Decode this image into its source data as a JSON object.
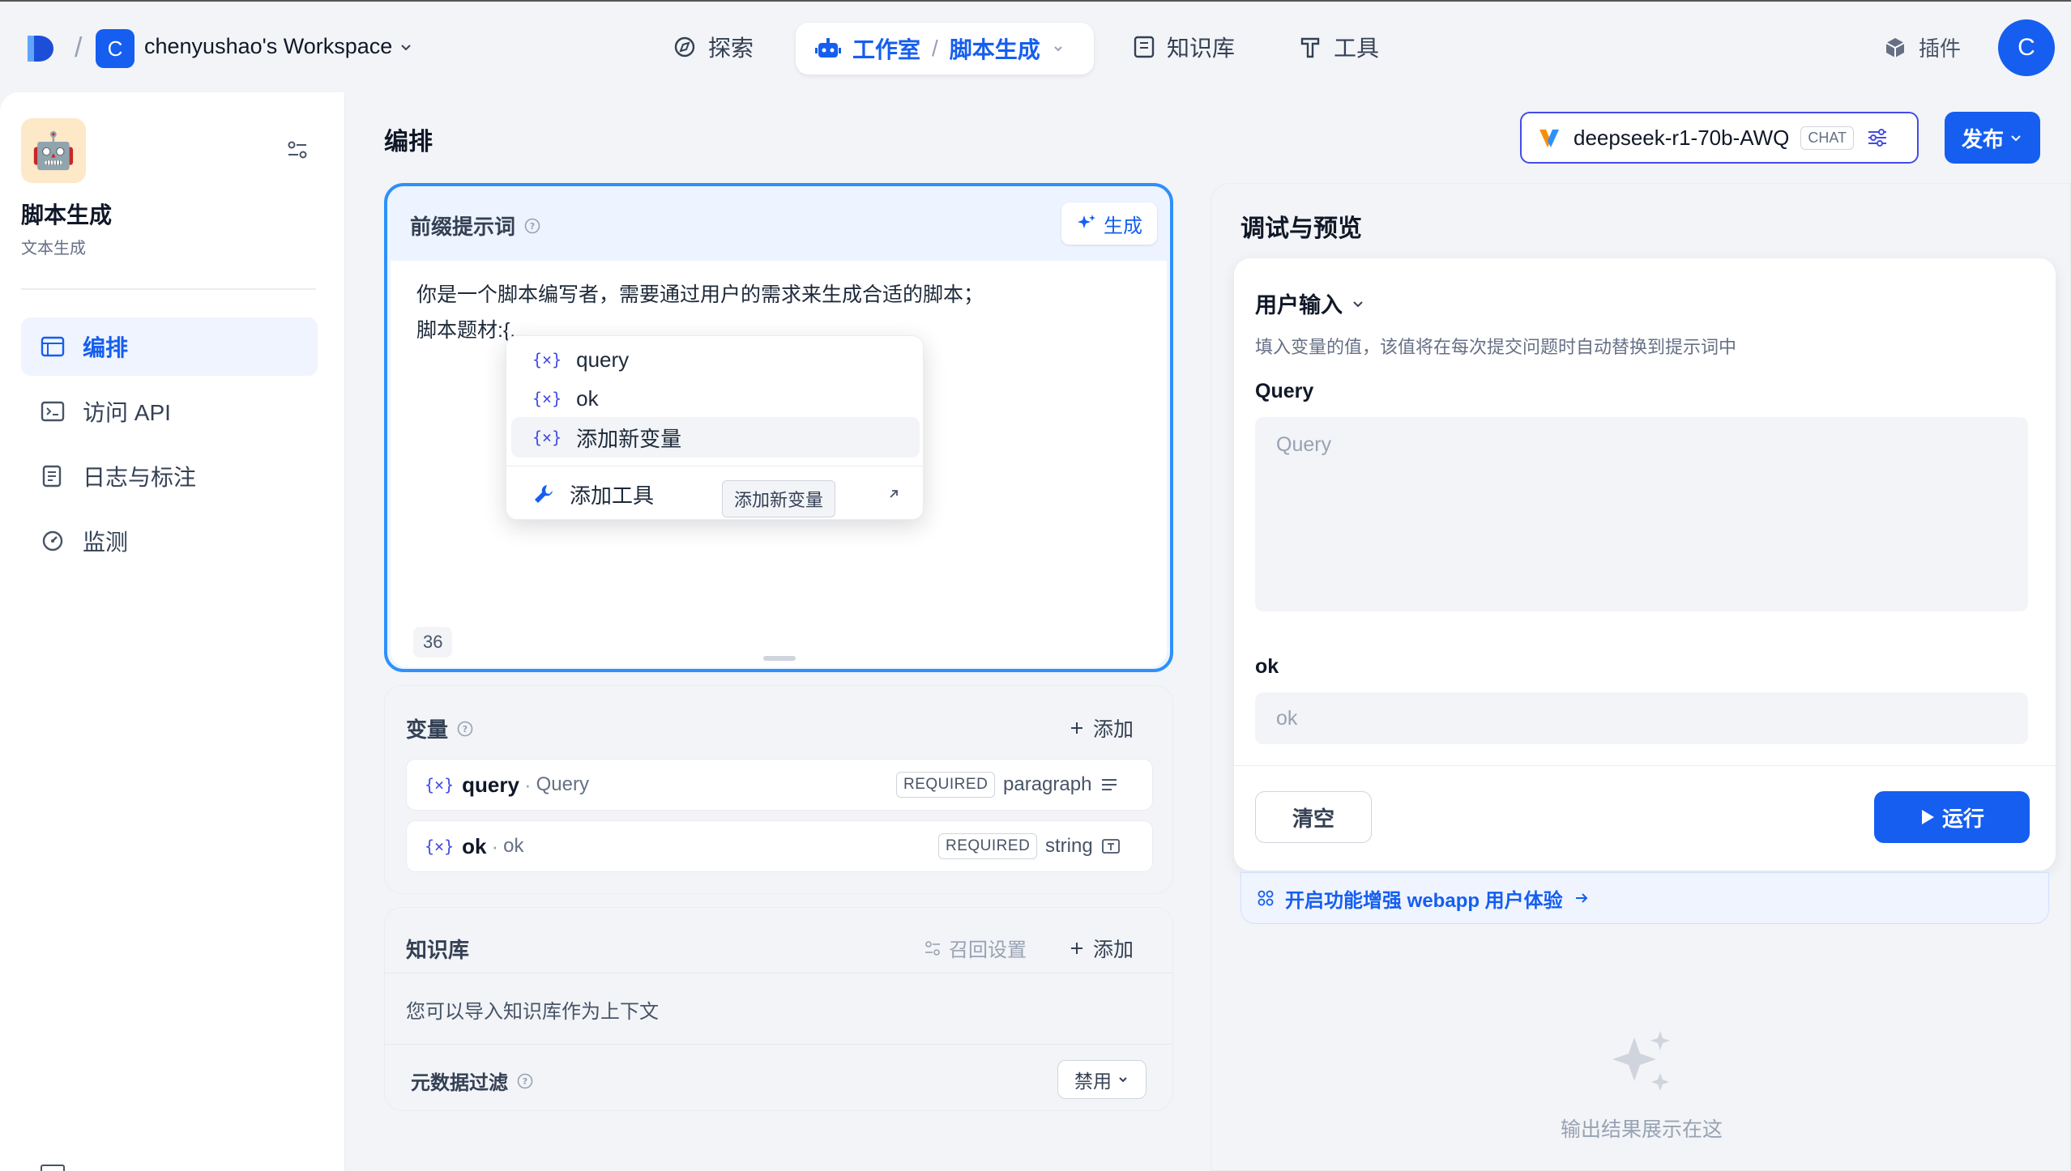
{
  "header": {
    "workspace_initial": "C",
    "workspace_name": "chenyushao's Workspace",
    "nav": {
      "explore": "探索",
      "studio": "工作室",
      "current_app": "脚本生成",
      "knowledge": "知识库",
      "tools": "工具"
    },
    "plugins": "插件",
    "user_initial": "C"
  },
  "sidebar": {
    "app_icon": "🤖",
    "app_name": "脚本生成",
    "app_type": "文本生成",
    "items": [
      {
        "label": "编排",
        "icon": "layout-icon",
        "active": true
      },
      {
        "label": "访问 API",
        "icon": "terminal-icon",
        "active": false
      },
      {
        "label": "日志与标注",
        "icon": "document-icon",
        "active": false
      },
      {
        "label": "监测",
        "icon": "gauge-icon",
        "active": false
      }
    ]
  },
  "main": {
    "title": "编排",
    "model": {
      "name": "deepseek-r1-70b-AWQ",
      "badge": "CHAT"
    },
    "publish": "发布",
    "prompt": {
      "title": "前缀提示词",
      "generate": "生成",
      "line1": "你是一个脚本编写者，需要通过用户的需求来生成合适的脚本；",
      "line2": "脚本题材:{,",
      "char_count": "36"
    },
    "dropdown": {
      "items": [
        "query",
        "ok",
        "添加新变量"
      ],
      "add_tool": "添加工具",
      "tooltip": "添加新变量"
    },
    "variables": {
      "title": "变量",
      "add": "添加",
      "rows": [
        {
          "key": "query",
          "label": "Query",
          "required": "REQUIRED",
          "type": "paragraph"
        },
        {
          "key": "ok",
          "label": "ok",
          "required": "REQUIRED",
          "type": "string"
        }
      ]
    },
    "knowledge": {
      "title": "知识库",
      "recall": "召回设置",
      "add": "添加",
      "desc": "您可以导入知识库作为上下文",
      "metadata_filter": "元数据过滤",
      "filter_value": "禁用"
    }
  },
  "debug": {
    "title": "调试与预览",
    "user_input": "用户输入",
    "desc": "填入变量的值，该值将在每次提交问题时自动替换到提示词中",
    "fields": [
      {
        "label": "Query",
        "placeholder": "Query"
      },
      {
        "label": "ok",
        "placeholder": "ok"
      }
    ],
    "clear": "清空",
    "run": "运行",
    "enhance": "开启功能增强 webapp 用户体验",
    "empty_output": "输出结果展示在这"
  },
  "colors": {
    "accent": "#155eef",
    "focus_border": "#2e90fa",
    "variable": "#444ce7"
  }
}
